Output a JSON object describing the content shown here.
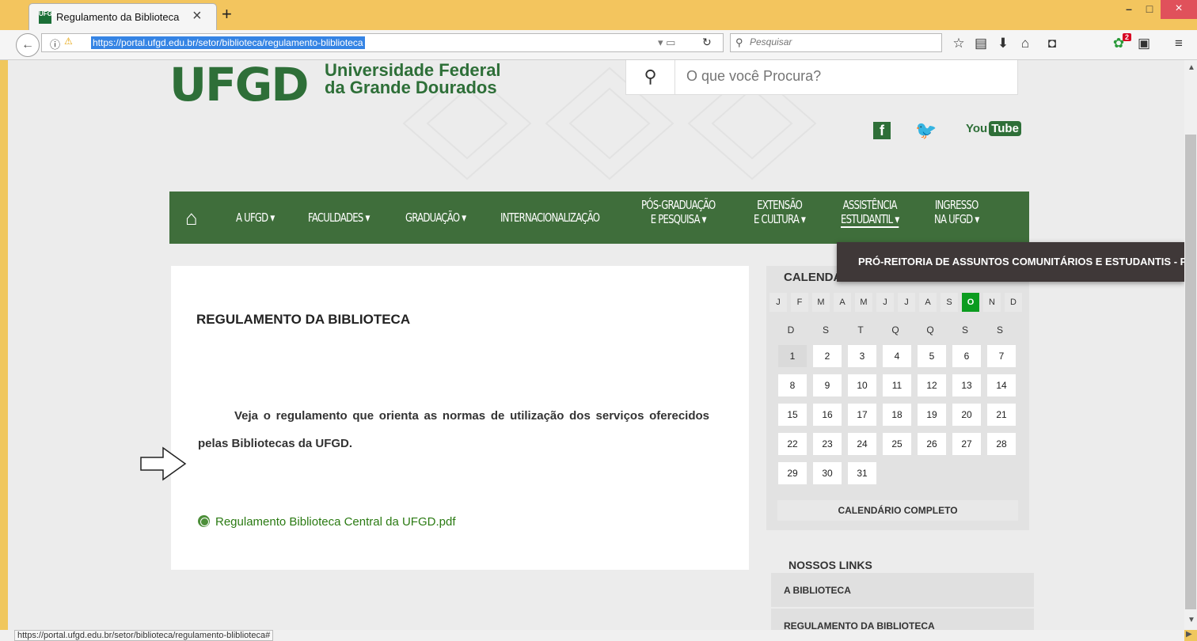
{
  "browser": {
    "tab_title": "Regulamento da Biblioteca",
    "tab_favicon_text": "UFGD",
    "url": "https://portal.ufgd.edu.br/setor/biblioteca/regulamento-bliblioteca",
    "search_placeholder": "Pesquisar",
    "notification_badge": "2",
    "status_url": "https://portal.ufgd.edu.br/setor/biblioteca/regulamento-bliblioteca#"
  },
  "site": {
    "logo": "UFGD",
    "name_line1": "Universidade Federal",
    "name_line2": "da Grande Dourados",
    "search_placeholder": "O que você Procura?",
    "social": {
      "facebook": "f",
      "youtube_left": "You",
      "youtube_right": "Tube"
    },
    "nav": {
      "items": [
        {
          "label": "A UFGD ▾"
        },
        {
          "label": "FACULDADES ▾"
        },
        {
          "label": "GRADUAÇÃO ▾"
        },
        {
          "label": "INTERNACIONALIZAÇÃO"
        },
        {
          "line1": "PÓS-GRADUAÇÃO",
          "line2": "E PESQUISA ▾"
        },
        {
          "line1": "EXTENSÃO",
          "line2": "E CULTURA ▾"
        },
        {
          "line1": "ASSISTÊNCIA",
          "line2": "ESTUDANTIL ▾"
        },
        {
          "line1": "INGRESSO",
          "line2": "NA UFGD ▾"
        }
      ],
      "submenu": "PRÓ-REITORIA DE ASSUNTOS COMUNITÁRIOS E ESTUDANTIS - PRAE"
    },
    "content": {
      "heading": "REGULAMENTO DA BIBLIOTECA",
      "body": "Veja o regulamento que orienta as normas de utilização dos serviços oferecidos pelas Bibliotecas da UFGD.",
      "link": "Regulamento Biblioteca Central da UFGD.pdf"
    },
    "calendar": {
      "title": "CALENDÁRIO",
      "months": [
        "J",
        "F",
        "M",
        "A",
        "M",
        "J",
        "J",
        "A",
        "S",
        "O",
        "N",
        "D"
      ],
      "current_month": "O",
      "weekdays": [
        "D",
        "S",
        "T",
        "Q",
        "Q",
        "S",
        "S"
      ],
      "days": [
        "1",
        "2",
        "3",
        "4",
        "5",
        "6",
        "7",
        "8",
        "9",
        "10",
        "11",
        "12",
        "13",
        "14",
        "15",
        "16",
        "17",
        "18",
        "19",
        "20",
        "21",
        "22",
        "23",
        "24",
        "25",
        "26",
        "27",
        "28",
        "29",
        "30",
        "31"
      ],
      "full_calendar": "CALENDÁRIO COMPLETO"
    },
    "links": {
      "title": "NOSSOS LINKS",
      "items": [
        "A BIBLIOTECA",
        "REGULAMENTO DA BIBLIOTECA"
      ]
    }
  },
  "colors": {
    "brand_green": "#2e6f38",
    "nav_green": "#3f6e3b",
    "calendar_current": "#0b9c1f"
  }
}
